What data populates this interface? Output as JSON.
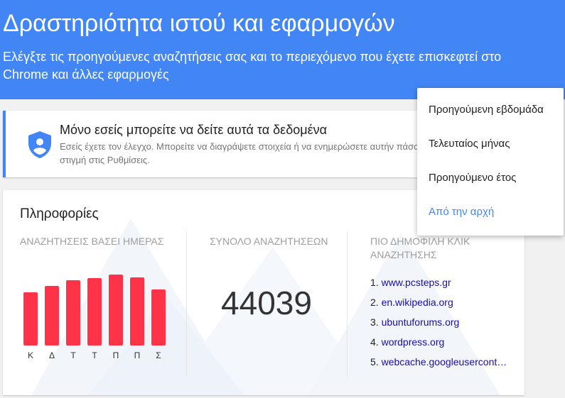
{
  "header": {
    "title": "Δραστηριότητα ιστού και εφαρμογών",
    "subtitle": "Ελέγξτε τις προηγούμενες αναζητήσεις σας και το περιεχόμενο που έχετε επισκεφτεί στο Chrome και άλλες εφαρμογές"
  },
  "privacy_card": {
    "title": "Μόνο εσείς μπορείτε να δείτε αυτά τα δεδομένα",
    "text": "Εσείς έχετε τον έλεγχο. Μπορείτε να διαγράψετε στοιχεία ή να ενημερώσετε αυτήν πάσα στιγμή στις Ρυθμίσεις.",
    "icon": "shield-icon"
  },
  "info_card": {
    "title": "Πληροφορίες",
    "searches_by_day_label": "ΑΝΑΖΗΤΗΣΕΙΣ ΒΑΣΕΙ ΗΜΕΡΑΣ",
    "total_searches_label": "ΣΥΝΟΛΟ ΑΝΑΖΗΤΗΣΕΩΝ",
    "total_searches_value": "44039",
    "top_clicks_label": "ΠΙΟ ΔΗΜΟΦΙΛΗ ΚΛΙΚ ΑΝΑΖΗΤΗΣΗΣ",
    "top_clicks": [
      {
        "num": "1.",
        "site": "www.pcsteps.gr"
      },
      {
        "num": "2.",
        "site": "en.wikipedia.org"
      },
      {
        "num": "3.",
        "site": "ubuntuforums.org"
      },
      {
        "num": "4.",
        "site": "wordpress.org"
      },
      {
        "num": "5.",
        "site": "webcache.googleusercont…"
      }
    ]
  },
  "chart_data": {
    "type": "bar",
    "categories": [
      "Κ",
      "Δ",
      "Τ",
      "Τ",
      "Π",
      "Π",
      "Σ"
    ],
    "values": [
      75,
      84,
      92,
      95,
      100,
      96,
      79
    ],
    "title": "",
    "xlabel": "",
    "ylabel": "",
    "ylim": [
      0,
      100
    ],
    "color": "#ff3347",
    "grid": false
  },
  "dropdown": {
    "items": [
      {
        "label": "Προηγούμενη εβδομάδα",
        "selected": false
      },
      {
        "label": "Τελευταίος μήνας",
        "selected": false
      },
      {
        "label": "Προηγούμενο έτος",
        "selected": false
      },
      {
        "label": "Από την αρχή",
        "selected": true
      }
    ],
    "accent_color": "#4285f4"
  },
  "colors": {
    "header_bg": "#4285f4",
    "bar_color": "#ff3347",
    "link_color": "#1a0dab"
  }
}
